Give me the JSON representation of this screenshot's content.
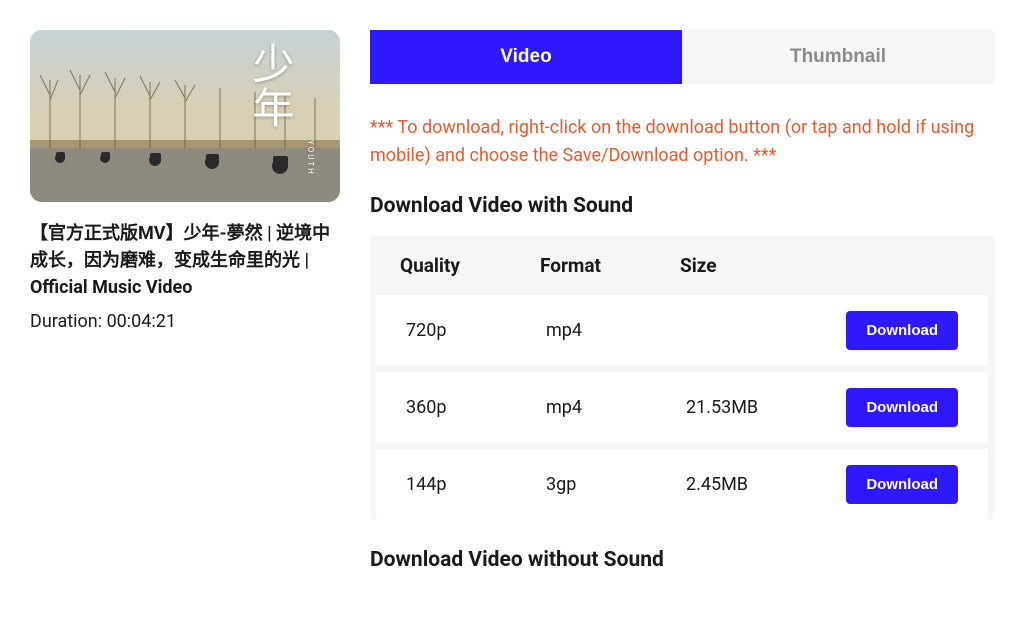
{
  "video": {
    "title": "【官方正式版MV】少年-夢然 | 逆境中成长，因为磨难，变成生命里的光 | Official Music Video",
    "duration_label": "Duration: 00:04:21",
    "thumb_overlay_main": "少年",
    "thumb_overlay_sub": "YOUTH"
  },
  "tabs": {
    "video": "Video",
    "thumbnail": "Thumbnail"
  },
  "instruction": "*** To download, right-click on the download button (or tap and hold if using mobile) and choose the Save/Download option. ***",
  "section_with_sound": "Download Video with Sound",
  "section_without_sound": "Download Video without Sound",
  "table": {
    "headers": {
      "quality": "Quality",
      "format": "Format",
      "size": "Size"
    },
    "download_label": "Download",
    "rows": [
      {
        "quality": "720p",
        "format": "mp4",
        "size": ""
      },
      {
        "quality": "360p",
        "format": "mp4",
        "size": "21.53MB"
      },
      {
        "quality": "144p",
        "format": "3gp",
        "size": "2.45MB"
      }
    ]
  }
}
